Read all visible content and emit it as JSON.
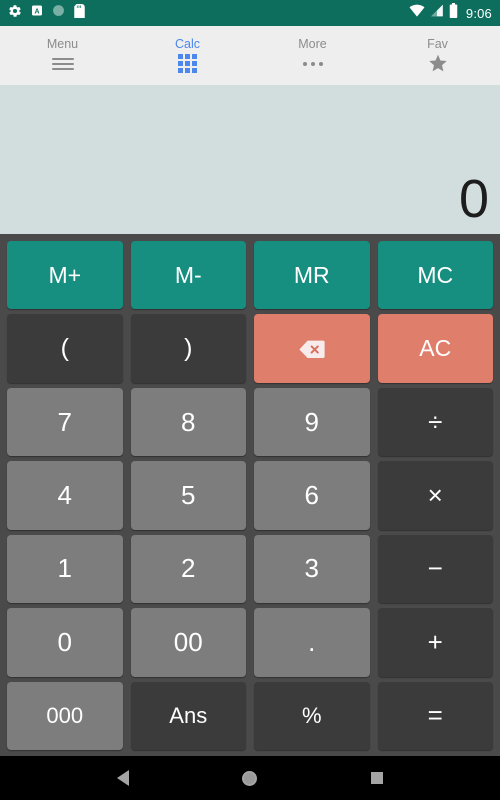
{
  "status_bar": {
    "background": "#0d6e5e",
    "left_icons": [
      "settings-gear-icon",
      "alphabet-mode-icon",
      "circle-icon",
      "sd-card-icon"
    ],
    "right_icons": [
      "wifi-icon",
      "signal-icon",
      "battery-icon"
    ],
    "time": "9:06"
  },
  "tabs": {
    "accent_color": "#4d87ec",
    "inactive_color": "#8c8c8c",
    "items": [
      {
        "label": "Menu",
        "icon": "hamburger-icon",
        "active": false
      },
      {
        "label": "Calc",
        "icon": "grid-icon",
        "active": true
      },
      {
        "label": "More",
        "icon": "overflow-dots-icon",
        "active": false
      },
      {
        "label": "Fav",
        "icon": "star-icon",
        "active": false
      }
    ]
  },
  "display": {
    "value": "0",
    "background": "#d2dedd"
  },
  "keypad": {
    "colors": {
      "memory": "#168e80",
      "danger": "#e07e6c",
      "number": "#7d7d7d",
      "operator": "#3b3b3b",
      "background": "#4a4a4a"
    },
    "rows": [
      [
        {
          "label": "M+",
          "kind": "mem"
        },
        {
          "label": "M-",
          "kind": "mem"
        },
        {
          "label": "MR",
          "kind": "mem"
        },
        {
          "label": "MC",
          "kind": "mem"
        }
      ],
      [
        {
          "label": "(",
          "kind": "op"
        },
        {
          "label": ")",
          "kind": "op"
        },
        {
          "label": "",
          "kind": "danger",
          "icon": "backspace-icon"
        },
        {
          "label": "AC",
          "kind": "danger"
        }
      ],
      [
        {
          "label": "7",
          "kind": "num"
        },
        {
          "label": "8",
          "kind": "num"
        },
        {
          "label": "9",
          "kind": "num"
        },
        {
          "label": "÷",
          "kind": "op"
        }
      ],
      [
        {
          "label": "4",
          "kind": "num"
        },
        {
          "label": "5",
          "kind": "num"
        },
        {
          "label": "6",
          "kind": "num"
        },
        {
          "label": "×",
          "kind": "op"
        }
      ],
      [
        {
          "label": "1",
          "kind": "num"
        },
        {
          "label": "2",
          "kind": "num"
        },
        {
          "label": "3",
          "kind": "num"
        },
        {
          "label": "−",
          "kind": "op"
        }
      ],
      [
        {
          "label": "0",
          "kind": "num"
        },
        {
          "label": "00",
          "kind": "num"
        },
        {
          "label": ".",
          "kind": "num"
        },
        {
          "label": "+",
          "kind": "op"
        }
      ],
      [
        {
          "label": "000",
          "kind": "num"
        },
        {
          "label": "Ans",
          "kind": "op"
        },
        {
          "label": "%",
          "kind": "op"
        },
        {
          "label": "=",
          "kind": "op"
        }
      ]
    ]
  },
  "nav_bar": {
    "buttons": [
      "back-button",
      "home-button",
      "recents-button"
    ]
  }
}
